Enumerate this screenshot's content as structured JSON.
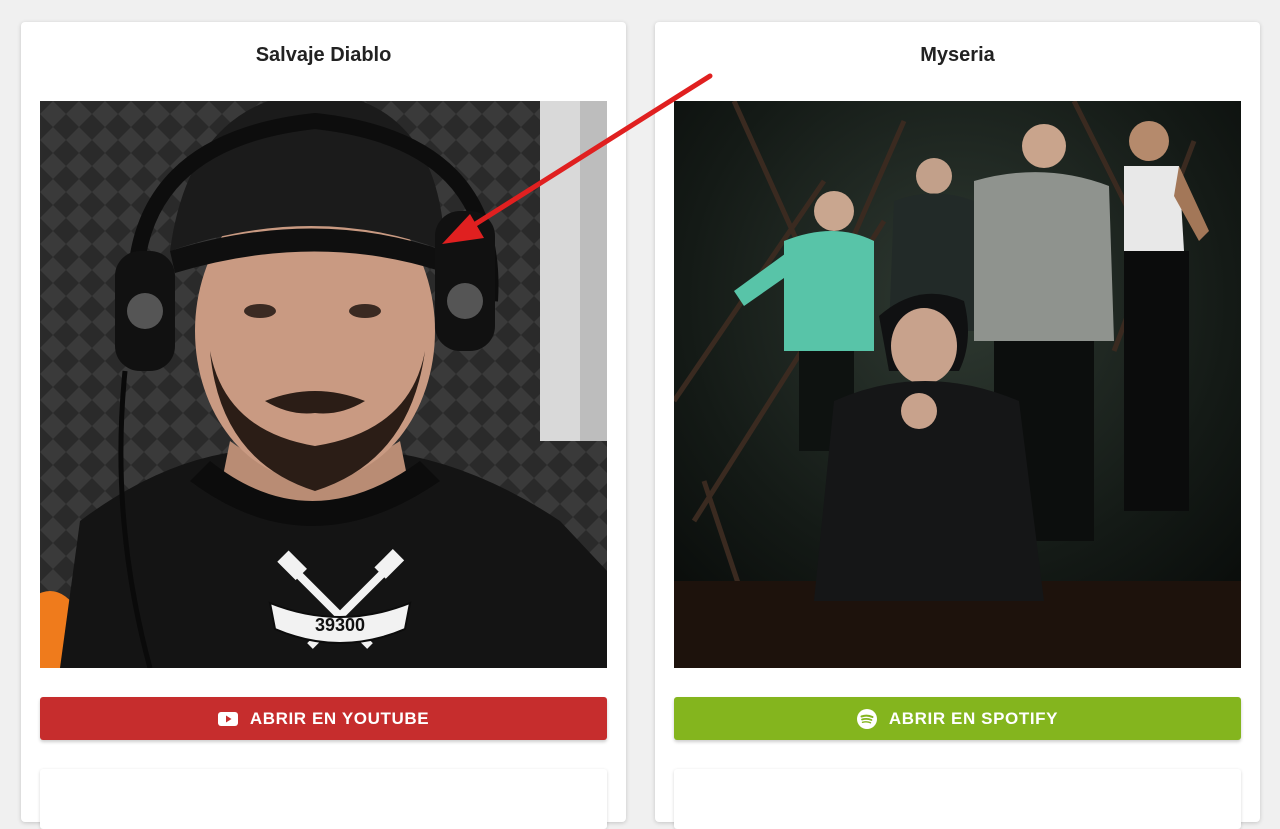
{
  "cards": [
    {
      "title": "Salvaje Diablo",
      "button_label": "ABRIR EN YOUTUBE",
      "button_color": "#c62d2d",
      "button_icon": "youtube-icon",
      "shirt_text": "39300"
    },
    {
      "title": "Myseria",
      "button_label": "ABRIR EN SPOTIFY",
      "button_color": "#84b51e",
      "button_icon": "spotify-icon"
    }
  ],
  "annotation": {
    "arrow_color": "#e02020"
  }
}
